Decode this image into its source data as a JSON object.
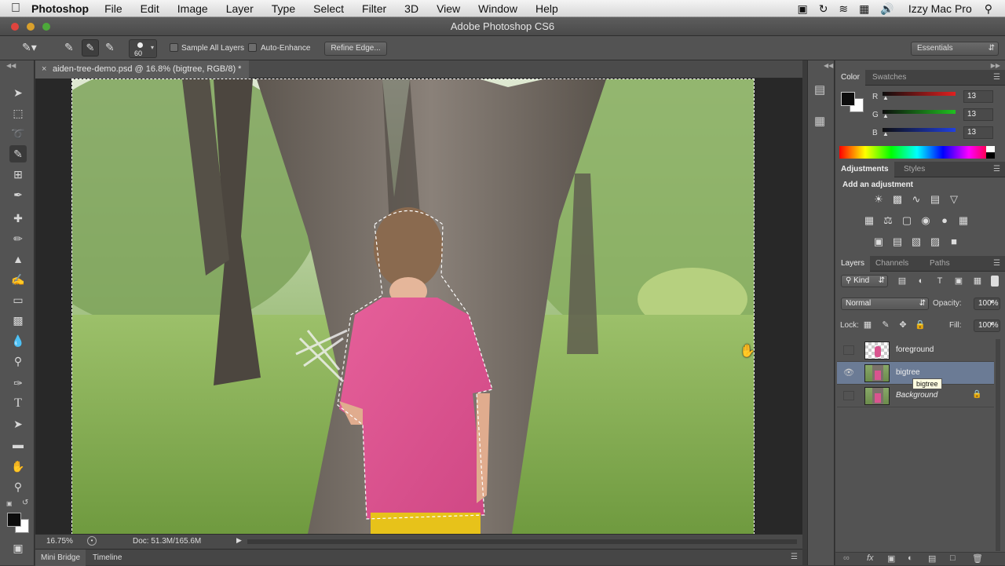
{
  "menubar": {
    "app": "Photoshop",
    "items": [
      "File",
      "Edit",
      "Image",
      "Layer",
      "Type",
      "Select",
      "Filter",
      "3D",
      "View",
      "Window",
      "Help"
    ],
    "user": "Izzy Mac Pro"
  },
  "window": {
    "title": "Adobe Photoshop CS6"
  },
  "options": {
    "brush_size": "60",
    "sample_all_layers": "Sample All Layers",
    "auto_enhance": "Auto-Enhance",
    "refine_edge": "Refine Edge...",
    "workspace": "Essentials"
  },
  "document": {
    "tab_title": "aiden-tree-demo.psd @ 16.8% (bigtree, RGB/8) *",
    "zoom": "16.75%",
    "doc_size": "Doc: 51.3M/165.6M"
  },
  "bottom_tabs": [
    "Mini Bridge",
    "Timeline"
  ],
  "color_panel": {
    "tabs": [
      "Color",
      "Swatches"
    ],
    "r_label": "R",
    "g_label": "G",
    "b_label": "B",
    "r": "13",
    "g": "13",
    "b": "13",
    "foreground": "#0d0d0d",
    "background": "#ffffff"
  },
  "adjustments_panel": {
    "tabs": [
      "Adjustments",
      "Styles"
    ],
    "heading": "Add an adjustment"
  },
  "layers_panel": {
    "tabs": [
      "Layers",
      "Channels",
      "Paths"
    ],
    "filter": "Kind",
    "blend_mode": "Normal",
    "opacity_label": "Opacity:",
    "opacity": "100%",
    "lock_label": "Lock:",
    "fill_label": "Fill:",
    "fill": "100%",
    "layers": [
      {
        "name": "foreground",
        "visible": false,
        "selected": false
      },
      {
        "name": "bigtree",
        "visible": true,
        "selected": true
      },
      {
        "name": "Background",
        "visible": false,
        "selected": false
      }
    ],
    "tooltip": "bigtree"
  }
}
